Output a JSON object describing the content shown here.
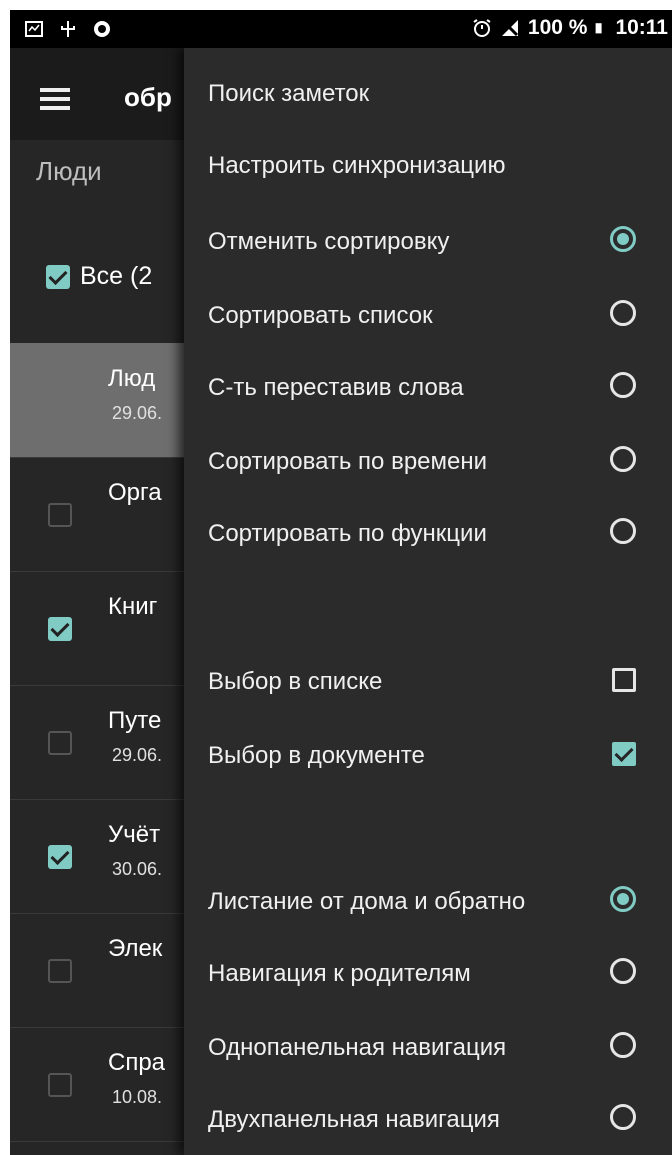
{
  "statusbar": {
    "battery": "100 %",
    "time": "10:11"
  },
  "toolbar": {
    "title": "обр"
  },
  "list": {
    "section": "Люди",
    "all_label": "Все (2",
    "items": [
      {
        "title": "Люд",
        "date": "29.06."
      },
      {
        "title": "Орга",
        "date": ""
      },
      {
        "title": "Книг",
        "date": ""
      },
      {
        "title": "Путе",
        "date": "29.06."
      },
      {
        "title": "Учёт",
        "date": "30.06."
      },
      {
        "title": "Элек",
        "date": ""
      },
      {
        "title": "Спра",
        "date": "10.08."
      }
    ]
  },
  "menu": {
    "search": "Поиск заметок",
    "sync": "Настроить синхронизацию",
    "sort_cancel": "Отменить сортировку",
    "sort_list": "Сортировать список",
    "sort_words": "С-ть переставив слова",
    "sort_time": "Сортировать по времени",
    "sort_function": "Сортировать по функции",
    "select_list": "Выбор в списке",
    "select_document": "Выбор в документе",
    "nav_home": "Листание от дома и обратно",
    "nav_parents": "Навигация к родителям",
    "nav_single": "Однопанельная навигация",
    "nav_double": "Двухпанельная навигация"
  },
  "colors": {
    "accent": "#80cbc4",
    "background": "#262626",
    "menu": "#2b2b2b"
  }
}
